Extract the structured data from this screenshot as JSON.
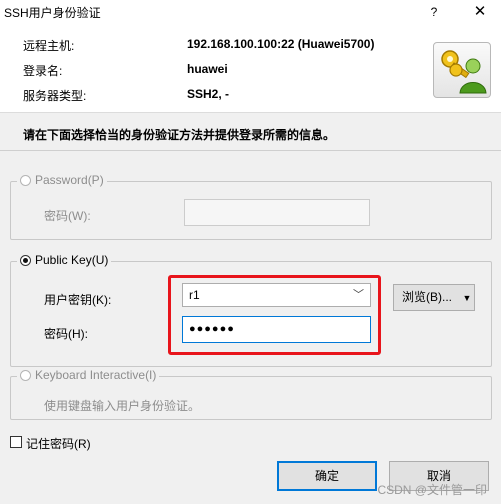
{
  "window": {
    "title": "SSH用户身份验证",
    "help_glyph": "?",
    "close_glyph": "✕"
  },
  "info": {
    "rows": [
      {
        "label": "远程主机:",
        "value": "192.168.100.100:22 (Huawei5700)"
      },
      {
        "label": "登录名:",
        "value": "huawei"
      },
      {
        "label": "服务器类型:",
        "value": "SSH2, -"
      }
    ],
    "icon": "keys-user-icon"
  },
  "instruction": "请在下面选择恰当的身份验证方法并提供登录所需的信息。",
  "password_method": {
    "label": "Password(P)",
    "checked": false,
    "enabled": false,
    "field_label": "密码(W):",
    "field_value": ""
  },
  "publickey_method": {
    "label": "Public Key(U)",
    "checked": true,
    "enabled": true,
    "user_key_label": "用户密钥(K):",
    "user_key_value": "r1",
    "browse_label": "浏览(B)...",
    "passphrase_label": "密码(H):",
    "passphrase_value": "●●●●●●"
  },
  "keyboard_method": {
    "label": "Keyboard Interactive(I)",
    "checked": false,
    "enabled": false,
    "description": "使用键盘输入用户身份验证。"
  },
  "remember": {
    "label": "记住密码(R)",
    "checked": false
  },
  "buttons": {
    "ok": "确定",
    "cancel": "取消"
  },
  "watermark": "CSDN @文件管一印",
  "colors": {
    "highlight": "#e8141b",
    "primary_border": "#0078d7"
  }
}
